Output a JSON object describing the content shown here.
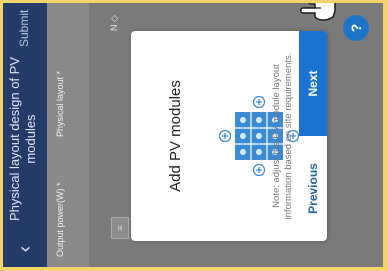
{
  "header": {
    "title": "Physical layout design of PV modules",
    "back_icon": "‹",
    "submit_label": "Submit"
  },
  "fields": {
    "output_power_label": "Output power(W) *",
    "physical_layout_label": "Physical layout *"
  },
  "controls": {
    "collapse_icon": "≡",
    "compass_icon": "N ◇"
  },
  "dialog": {
    "title": "Add PV modules",
    "note": "Note: adjust the PV module layout information based on site requirements.",
    "previous_label": "Previous",
    "next_label": "Next"
  },
  "help": {
    "label": "?"
  },
  "colors": {
    "header_bg": "#243a67",
    "accent_blue": "#1b73d1",
    "module_blue": "#3a8ad6",
    "overlay_gray": "#7f7f7f",
    "frame_yellow": "#f4d36a"
  },
  "icons": {
    "hand": "pointing-hand-icon",
    "help": "help-circle-icon"
  }
}
